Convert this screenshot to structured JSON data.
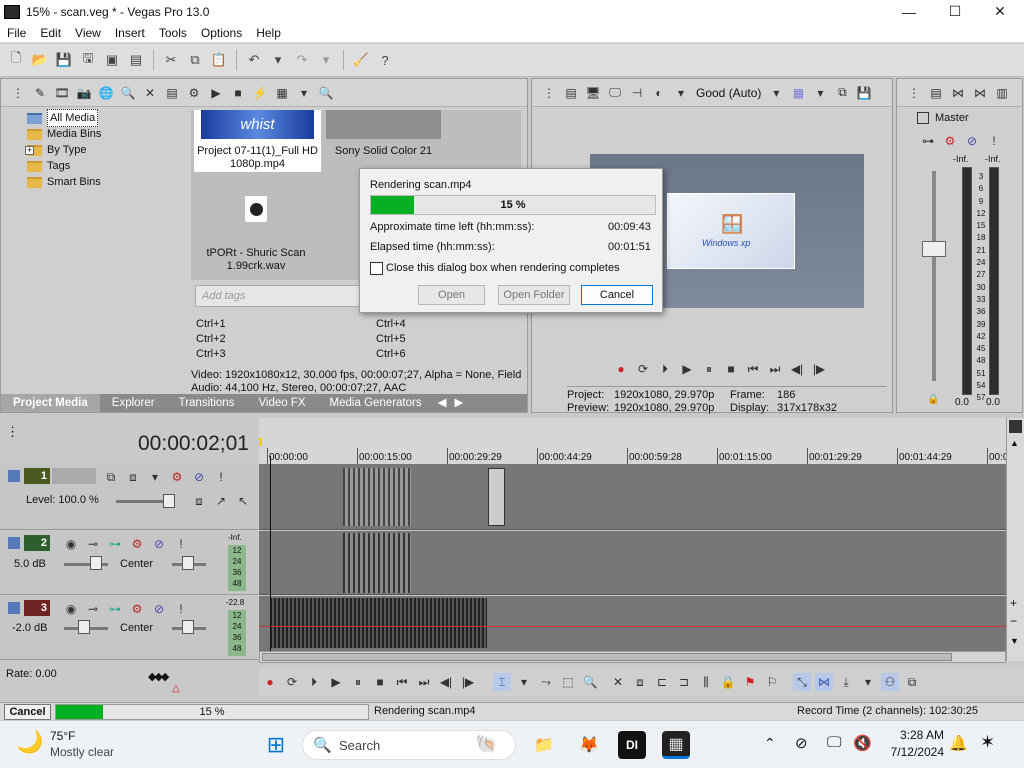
{
  "window": {
    "title": "15% - scan.veg * - Vegas Pro 13.0",
    "minimize": "—",
    "maximize": "☐",
    "close": "✕"
  },
  "menu": [
    "File",
    "Edit",
    "View",
    "Insert",
    "Tools",
    "Options",
    "Help"
  ],
  "media": {
    "tree": [
      "All Media",
      "Media Bins",
      "By Type",
      "Tags",
      "Smart Bins"
    ],
    "expander": "+",
    "items": [
      {
        "name": "Project 07-11(1)_Full HD 1080p.mp4"
      },
      {
        "name": "Sony Solid Color 21"
      },
      {
        "name": "tPORt - Shuric Scan 1.99crk.wav"
      }
    ],
    "thumb_text": "whist",
    "tag_placeholder": "Add tags",
    "shortcuts": [
      "Ctrl+1",
      "Ctrl+2",
      "Ctrl+3",
      "Ctrl+4",
      "Ctrl+5",
      "Ctrl+6"
    ],
    "info_video": "Video: 1920x1080x12, 30.000 fps, 00:00:07;27, Alpha = None, Field",
    "info_audio": "Audio: 44,100 Hz, Stereo, 00:00:07;27, AAC",
    "tabs": [
      "Project Media",
      "Explorer",
      "Transitions",
      "Video FX",
      "Media Generators"
    ]
  },
  "preview": {
    "quality": "Good (Auto)",
    "project_label": "Project:",
    "project_value": "1920x1080, 29.970p",
    "preview_label": "Preview:",
    "preview_value": "1920x1080, 29.970p",
    "frame_label": "Frame:",
    "frame_value": "186",
    "display_label": "Display:",
    "display_value": "317x178x32",
    "xp_text": "Windows xp"
  },
  "master": {
    "title": "Master",
    "inf_left": "-Inf.",
    "inf_right": "-Inf.",
    "scale": [
      "3",
      "6",
      "9",
      "12",
      "15",
      "18",
      "21",
      "24",
      "27",
      "30",
      "33",
      "36",
      "39",
      "42",
      "45",
      "48",
      "51",
      "54",
      "57"
    ],
    "level_left": "0.0",
    "level_right": "0.0"
  },
  "dialog": {
    "title": "Rendering scan.mp4",
    "progress": 15,
    "progress_text": "15 %",
    "time_left_label": "Approximate time left (hh:mm:ss):",
    "time_left": "00:09:43",
    "elapsed_label": "Elapsed time (hh:mm:ss):",
    "elapsed": "00:01:51",
    "checkbox_label": "Close this dialog box when rendering completes",
    "open": "Open",
    "open_folder": "Open Folder",
    "cancel": "Cancel"
  },
  "timeline": {
    "timecode": "00:00:02;01",
    "ruler": [
      "00:00:00",
      "00:00:15:00",
      "00:00:29:29",
      "00:00:44:29",
      "00:00:59:28",
      "00:01:15:00",
      "00:01:29:29",
      "00:01:44:29",
      "00:0"
    ],
    "tracks": [
      {
        "num": "1",
        "color": "#5a6b2a",
        "level_label": "Level: 100.0 %"
      },
      {
        "num": "2",
        "color": "#3c6e3c",
        "vol": "5.0 dB",
        "pan": "Center",
        "meter_top": "-Inf.",
        "meter": [
          "12",
          "24",
          "36",
          "48"
        ]
      },
      {
        "num": "3",
        "color": "#7a2a2a",
        "vol": "-2.0 dB",
        "pan": "Center",
        "meter_top": "-22.8",
        "meter": [
          "12",
          "24",
          "36",
          "48"
        ]
      }
    ],
    "rate": "Rate: 0.00"
  },
  "status": {
    "cancel": "Cancel",
    "progress": 15,
    "progress_text": "15 %",
    "message": "Rendering scan.mp4",
    "record_time": "Record Time (2 channels): 102:30:25"
  },
  "taskbar": {
    "temp": "75°F",
    "weather": "Mostly clear",
    "search": "Search",
    "time": "3:28 AM",
    "date": "7/12/2024"
  },
  "colors": {
    "progress": "#06b025",
    "accent": "#0078d4"
  }
}
